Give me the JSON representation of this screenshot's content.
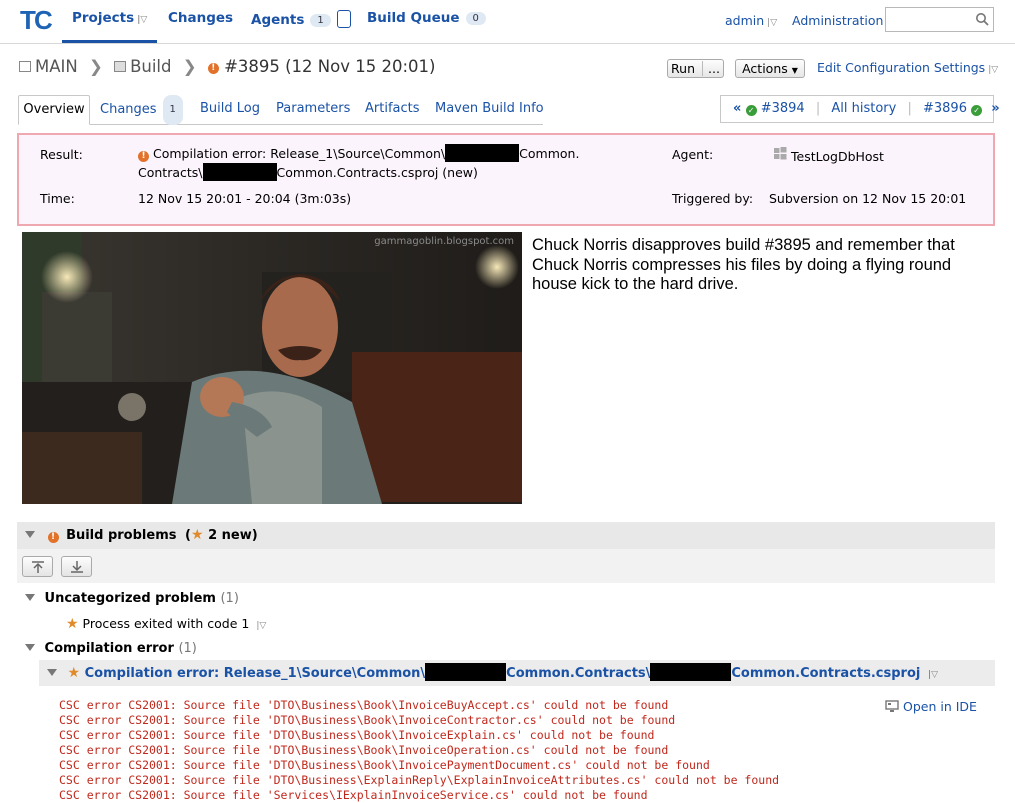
{
  "header": {
    "nav": {
      "projects": "Projects",
      "changes": "Changes",
      "agents": "Agents",
      "agents_count": "1",
      "build_queue": "Build Queue",
      "build_queue_count": "0"
    },
    "user": "admin",
    "administration": "Administration"
  },
  "breadcrumb": {
    "project": "MAIN",
    "build_config": "Build",
    "build": "#3895 (12 Nov 15 20:01)"
  },
  "toolbar": {
    "run": "Run",
    "run_more": "...",
    "actions": "Actions",
    "edit_settings": "Edit Configuration Settings"
  },
  "tabs": {
    "overview": "Overview",
    "changes": "Changes",
    "changes_count": "1",
    "build_log": "Build Log",
    "parameters": "Parameters",
    "artifacts": "Artifacts",
    "maven": "Maven Build Info"
  },
  "history": {
    "prev": "#3894",
    "all": "All history",
    "next": "#3896"
  },
  "result": {
    "result_label": "Result:",
    "result_part1": "Compilation error: Release_1\\Source\\Common\\",
    "result_part2": "Common.",
    "result_part3": "Contracts\\",
    "result_part4": "Common.Contracts.csproj (new)",
    "time_label": "Time:",
    "time_value": "12 Nov 15 20:01 - 20:04 (3m:03s)",
    "agent_label": "Agent:",
    "agent_value": "TestLogDbHost",
    "triggered_label": "Triggered by:",
    "triggered_value": "Subversion on 12 Nov 15 20:01"
  },
  "image": {
    "watermark": "gammagoblin.blogspot.com"
  },
  "chuck_text": "Chuck Norris disapproves build #3895 and remember that Chuck Norris compresses his files by doing a flying round house kick to the hard drive.",
  "problems": {
    "title": "Build problems",
    "new_count": "2 new",
    "uncategorized": "Uncategorized problem",
    "uncategorized_count": "(1)",
    "process_exited": "Process exited with code 1",
    "compilation": "Compilation error",
    "compilation_count": "(1)",
    "ce_part1": "Compilation error: Release_1\\Source\\Common\\",
    "ce_part2": "Common.Contracts\\",
    "ce_part3": "Common.Contracts.csproj",
    "open_ide": "Open in IDE"
  },
  "log_lines": [
    "CSC error CS2001: Source file 'DTO\\Business\\Book\\InvoiceBuyAccept.cs' could not be found",
    "CSC error CS2001: Source file 'DTO\\Business\\Book\\InvoiceContractor.cs' could not be found",
    "CSC error CS2001: Source file 'DTO\\Business\\Book\\InvoiceExplain.cs' could not be found",
    "CSC error CS2001: Source file 'DTO\\Business\\Book\\InvoiceOperation.cs' could not be found",
    "CSC error CS2001: Source file 'DTO\\Business\\Book\\InvoicePaymentDocument.cs' could not be found",
    "CSC error CS2001: Source file 'DTO\\Business\\ExplainReply\\ExplainInvoiceAttributes.cs' could not be found",
    "CSC error CS2001: Source file 'Services\\IExplainInvoiceService.cs' could not be found"
  ],
  "colors": {
    "link": "#1a52a6",
    "result_border": "#f0a8b0",
    "result_bg": "#fcf4fd",
    "error_text": "#c0281c",
    "ok_green": "#3a9d3a",
    "error_orange": "#e2722a"
  },
  "icons": [
    "teamcity-logo",
    "search-icon",
    "project-icon",
    "build-config-icon",
    "error-icon",
    "success-icon",
    "windows-icon",
    "star-icon",
    "collapse-icon",
    "expand-icon",
    "open-in-ide-icon"
  ]
}
